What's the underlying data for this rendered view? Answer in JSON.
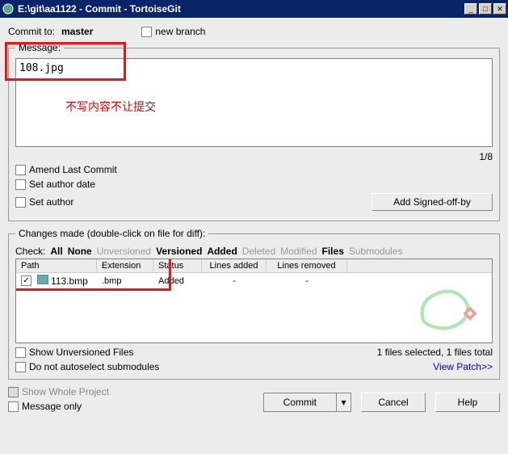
{
  "title": "E:\\git\\aa1122 - Commit - TortoiseGit",
  "commitTo": {
    "label": "Commit to:",
    "branch": "master"
  },
  "newBranch": "new branch",
  "message": {
    "legend": "Message:",
    "text": "108.jpg",
    "annotation": "不写内容不让提交",
    "counter": "1/8"
  },
  "options": {
    "amend": "Amend Last Commit",
    "setDate": "Set author date",
    "setAuthor": "Set author",
    "signoff": "Add Signed-off-by"
  },
  "changes": {
    "legend": "Changes made (double-click on file for diff):",
    "checkLabel": "Check:",
    "links": {
      "all": "All",
      "none": "None",
      "unversioned": "Unversioned",
      "versioned": "Versioned",
      "added": "Added",
      "deleted": "Deleted",
      "modified": "Modified",
      "files": "Files",
      "submodules": "Submodules"
    },
    "columns": {
      "path": "Path",
      "ext": "Extension",
      "status": "Status",
      "added": "Lines added",
      "removed": "Lines removed"
    },
    "rows": [
      {
        "checked": true,
        "path": "113.bmp",
        "ext": ".bmp",
        "status": "Added",
        "added": "-",
        "removed": "-"
      }
    ],
    "showUnversioned": "Show Unversioned Files",
    "noAutoselect": "Do not autoselect submodules",
    "summary": "1 files selected, 1 files total",
    "viewPatch": "View Patch>>"
  },
  "footer": {
    "showWhole": "Show Whole Project",
    "messageOnly": "Message only",
    "commit": "Commit",
    "cancel": "Cancel",
    "help": "Help"
  }
}
